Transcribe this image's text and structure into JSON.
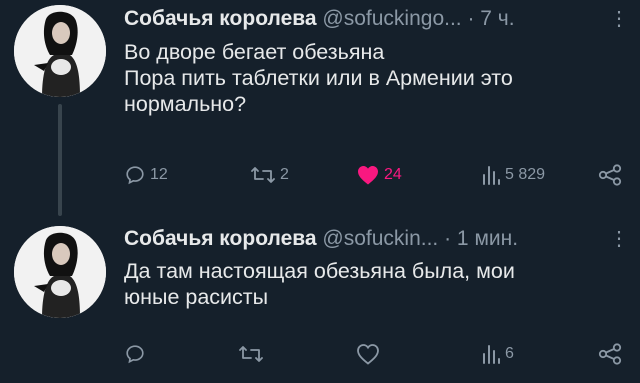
{
  "tweets": [
    {
      "name": "Собачья королева",
      "handle": "@sofuckingo...",
      "time": "· 7 ч.",
      "more": "⋮",
      "lines": [
        "Во дворе бегает обезьяна",
        "Пора пить таблетки или в Армении это",
        "нормально?"
      ],
      "replies": "12",
      "retweets": "2",
      "likes": "24",
      "views": "5 829",
      "liked": true
    },
    {
      "name": "Собачья королева",
      "handle": "@sofuckin...",
      "time": "· 1 мин.",
      "more": "⋮",
      "lines": [
        "Да там настоящая обезьяна была, мои",
        "юные расисты"
      ],
      "replies": "",
      "retweets": "",
      "likes": "",
      "views": "6",
      "liked": false
    }
  ],
  "colors": {
    "background": "#15202b",
    "text": "#e7e9ea",
    "muted": "#8b98a5",
    "like": "#f91880",
    "thread_line": "#38444d"
  },
  "icons": [
    "reply-icon",
    "retweet-icon",
    "like-icon",
    "views-icon",
    "share-icon",
    "more-icon"
  ]
}
